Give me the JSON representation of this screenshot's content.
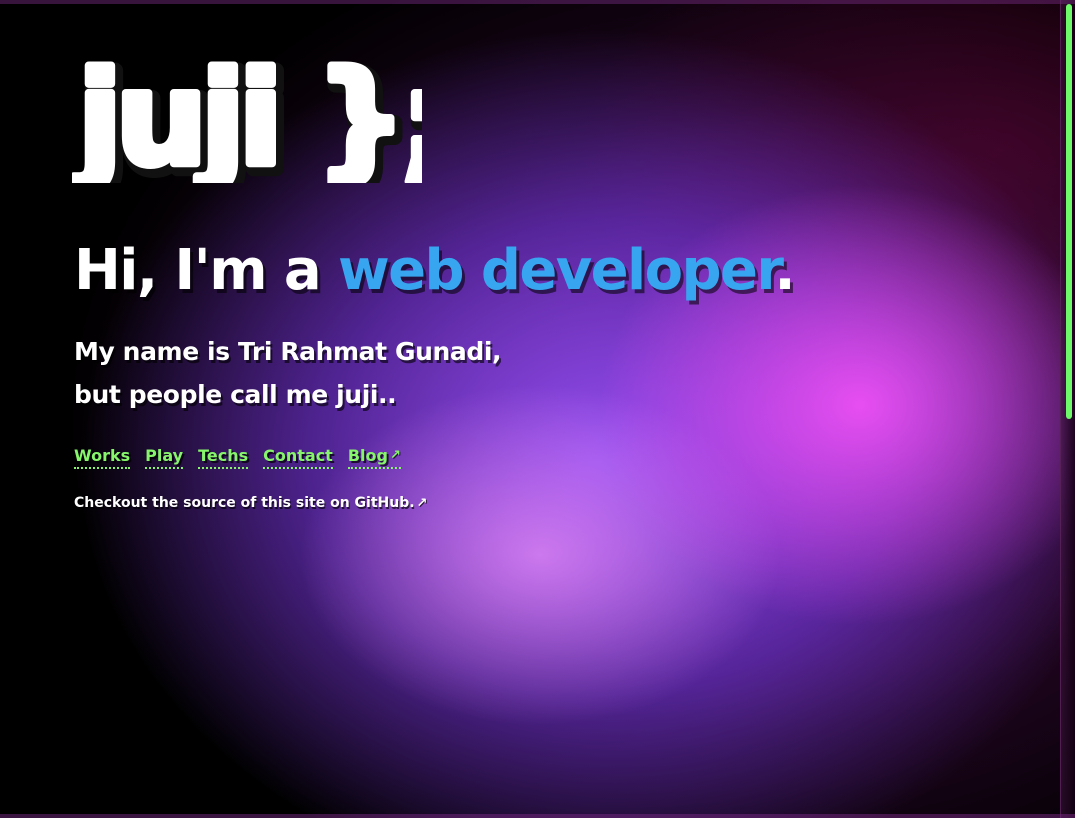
{
  "logo": {
    "text": "juji };"
  },
  "hero": {
    "headline_prefix": "Hi, I'm a ",
    "headline_accent": "web developer",
    "headline_suffix": ".",
    "intro_line1": "My name is Tri Rahmat Gunadi,",
    "intro_line2": "but people call me juji.."
  },
  "nav": {
    "works": "Works",
    "play": "Play",
    "techs": "Techs",
    "contact": "Contact",
    "blog": "Blog",
    "external_icon": "↗"
  },
  "footer": {
    "source_text": "Checkout the source of this site on GitHub.",
    "external_icon": "↗"
  },
  "colors": {
    "accent": "#38a5f0",
    "link": "#86f56b",
    "scrollbar": "#6ef96a"
  }
}
